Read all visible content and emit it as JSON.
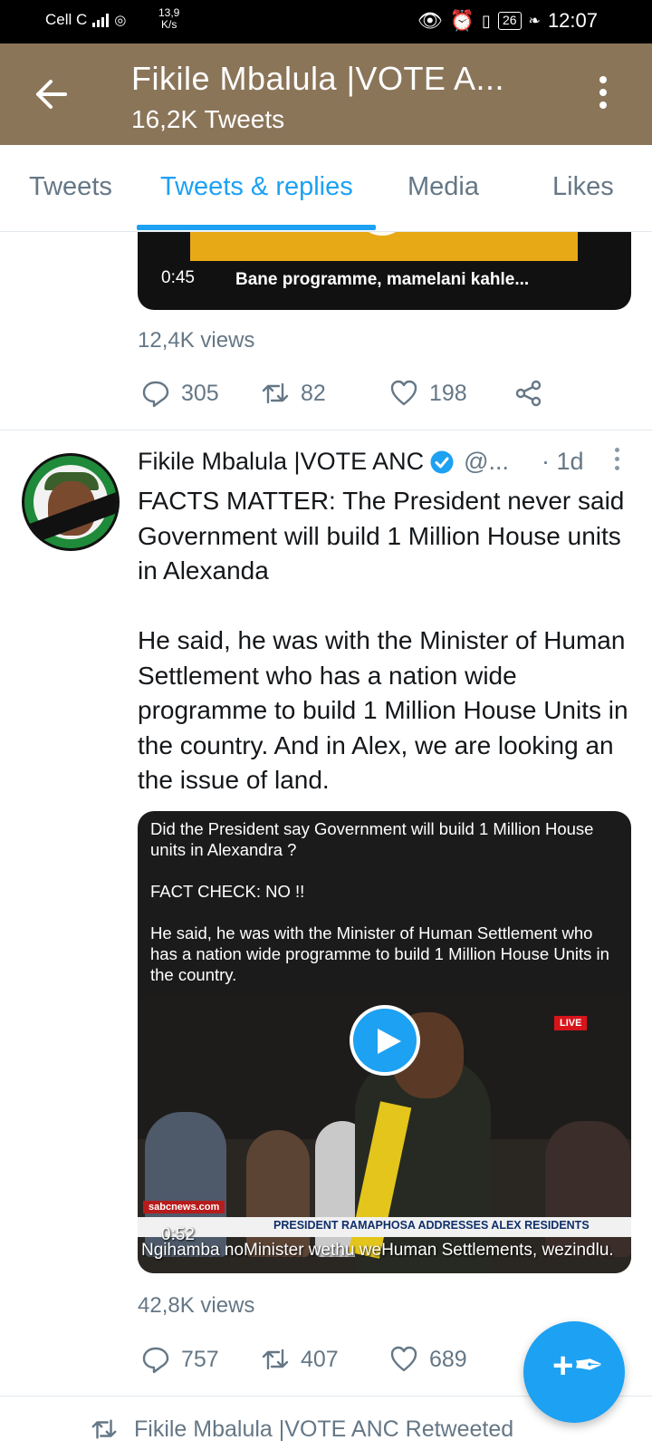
{
  "status_bar": {
    "carrier": "Cell C",
    "network_speed_value": "13,9",
    "network_speed_unit": "K/s",
    "battery": "26",
    "time": "12:07"
  },
  "header": {
    "title": "Fikile Mbalula |VOTE A...",
    "subtitle": "16,2K Tweets"
  },
  "tabs": [
    {
      "label": "Tweets",
      "active": false
    },
    {
      "label": "Tweets & replies",
      "active": true
    },
    {
      "label": "Media",
      "active": false
    },
    {
      "label": "Likes",
      "active": false
    }
  ],
  "tweet1": {
    "video_time": "0:45",
    "video_caption": "Bane programme, mamelani kahle...",
    "views": "12,4K views",
    "replies": "305",
    "retweets": "82",
    "likes": "198"
  },
  "tweet2": {
    "author": "Fikile Mbalula |VOTE ANC",
    "handle": "@...",
    "time": "· 1d",
    "body_p1": "FACTS MATTER: The President never said Government will build 1 Million House units in Alexanda",
    "body_p2": "He said, he was with the Minister of Human Settlement who has a nation wide programme to build 1 Million House Units in the country. And in Alex, we are looking an the issue of land.",
    "video": {
      "text_1": "Did the President say Government will build 1 Million House units in Alexandra ?",
      "text_2": "FACT CHECK: NO !!",
      "text_3": "He said, he was with the Minister of Human Settlement who has a nation wide programme to build 1 Million House Units in the country.",
      "live_label": "LIVE",
      "brand": "sabcnews.com",
      "headline": "PRESIDENT RAMAPHOSA ADDRESSES ALEX RESIDENTS",
      "subtitle": "Ngihamba noMinister wethu weHuman Settlements, wezindlu.",
      "time": "0:52"
    },
    "views": "42,8K views",
    "replies": "757",
    "retweets": "407",
    "likes": "689"
  },
  "retweet_notice": "Fikile Mbalula |VOTE ANC Retweeted",
  "fab_icon": "compose-tweet-icon",
  "colors": {
    "header_bg": "#8b7559",
    "accent": "#1da1f2",
    "muted_text": "#657786"
  }
}
